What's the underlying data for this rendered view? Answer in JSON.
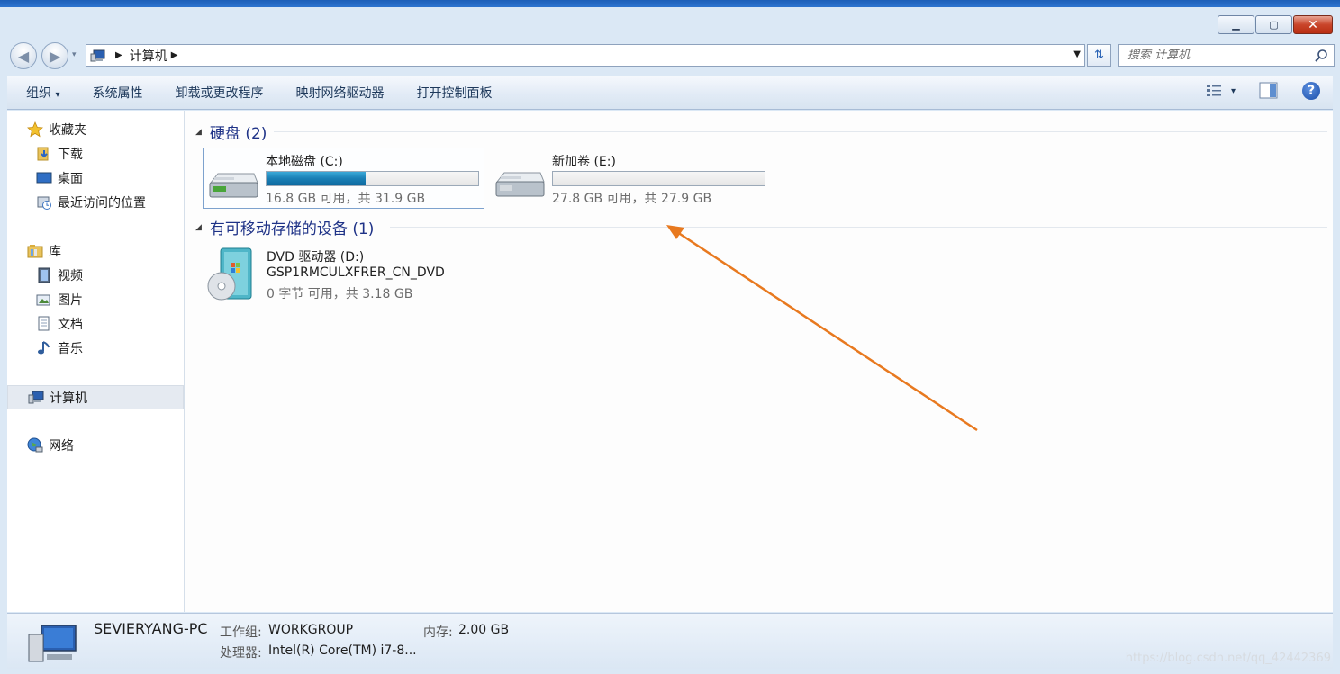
{
  "window": {
    "minimize_glyph": "▁",
    "maximize_glyph": "▢",
    "close_glyph": "✕"
  },
  "nav": {
    "back_glyph": "◀",
    "forward_glyph": "▶",
    "dropdown_glyph": "▾",
    "address_path": "计算机",
    "address_sep_glyph": "▶",
    "address_dropdown_glyph": "▼",
    "refresh_glyph": "⇅",
    "search_placeholder": "搜索 计算机"
  },
  "toolbar": {
    "organize": "组织",
    "organize_arrow": "▾",
    "system_properties": "系统属性",
    "uninstall_programs": "卸载或更改程序",
    "map_network_drive": "映射网络驱动器",
    "open_control_panel": "打开控制面板",
    "views_arrow": "▾",
    "help_glyph": "?"
  },
  "sidebar": {
    "favorites": "收藏夹",
    "downloads": "下载",
    "desktop": "桌面",
    "recent_places": "最近访问的位置",
    "libraries": "库",
    "videos": "视频",
    "pictures": "图片",
    "documents": "文档",
    "music": "音乐",
    "computer": "计算机",
    "network": "网络"
  },
  "groups": {
    "hard_disks": "硬盘 (2)",
    "removable": "有可移动存储的设备 (1)"
  },
  "drives": [
    {
      "name": "本地磁盘 (C:)",
      "info": "16.8 GB 可用，共 31.9 GB",
      "used_fraction": 0.47
    },
    {
      "name": "新加卷 (E:)",
      "info": "27.8 GB 可用，共 27.9 GB",
      "used_fraction": 0.0
    }
  ],
  "dvd": {
    "name": "DVD 驱动器 (D:)",
    "label": "GSP1RMCULXFRER_CN_DVD",
    "info": "0 字节 可用，共 3.18 GB"
  },
  "details": {
    "computer_name": "SEVIERYANG-PC",
    "workgroup_label": "工作组:",
    "workgroup_value": "WORKGROUP",
    "memory_label": "内存:",
    "memory_value": "2.00 GB",
    "processor_label": "处理器:",
    "processor_value": "Intel(R) Core(TM) i7-8..."
  },
  "watermark": "https://blog.csdn.net/qq_42442369",
  "colors": {
    "annotation_arrow": "#e8791f",
    "progress_fill": "#1a7fb5",
    "group_header": "#1e3287"
  }
}
